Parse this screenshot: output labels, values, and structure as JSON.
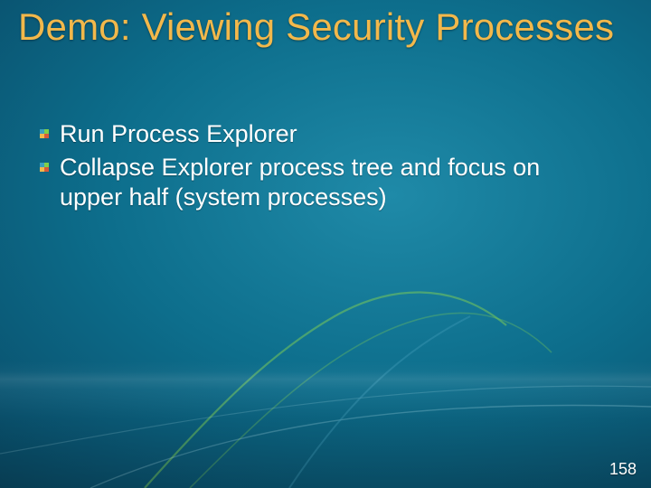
{
  "title": "Demo: Viewing Security Processes",
  "bullets": [
    "Run Process Explorer",
    "Collapse Explorer process tree and focus on upper half (system processes)"
  ],
  "page_number": "158",
  "colors": {
    "title": "#f2b84b",
    "text": "#ffffff",
    "bg_center": "#1f8aa8",
    "bg_edge": "#052c3f"
  }
}
